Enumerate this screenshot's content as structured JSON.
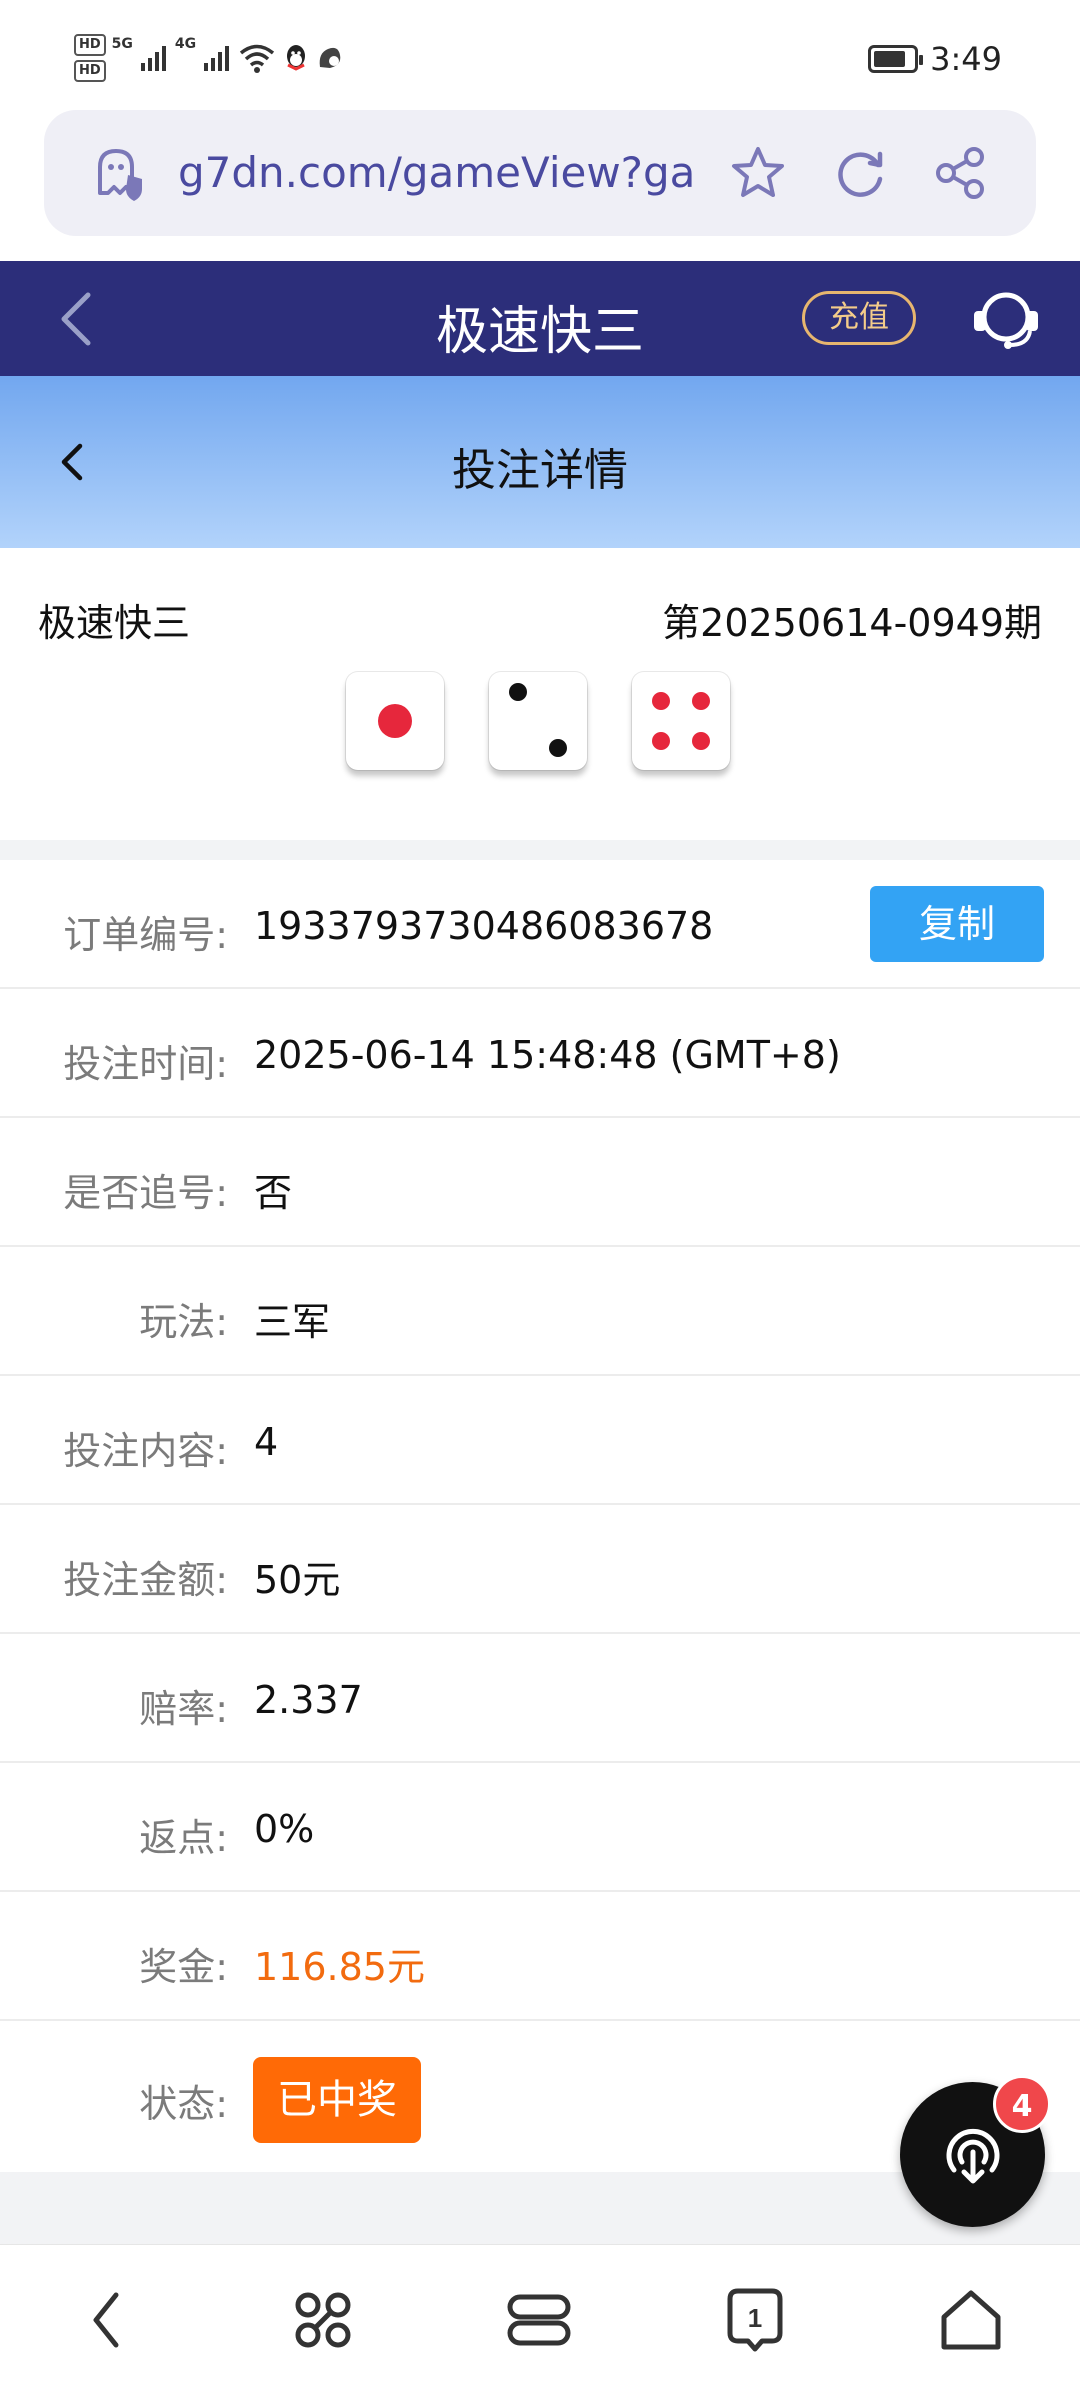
{
  "status_bar": {
    "hd1": "HD",
    "hd2": "HD",
    "net1": "5G",
    "net2": "4G",
    "time": "3:49",
    "battery_level": 0.8
  },
  "browser": {
    "url": "g7dn.com/gameView?ga"
  },
  "header": {
    "title": "极速快三",
    "recharge_label": "充值"
  },
  "sub_header": {
    "title": "投注详情"
  },
  "game": {
    "name": "极速快三",
    "period": "第20250614-0949期",
    "dice": [
      1,
      2,
      4
    ]
  },
  "details": {
    "order_no": {
      "label": "订单编号:",
      "value": "1933793730486083678",
      "copy_label": "复制"
    },
    "bet_time": {
      "label": "投注时间:",
      "value": "2025-06-14 15:48:48 (GMT+8)"
    },
    "chase": {
      "label": "是否追号:",
      "value": "否"
    },
    "play": {
      "label": "玩法:",
      "value": "三军"
    },
    "content": {
      "label": "投注内容:",
      "value": "4"
    },
    "amount": {
      "label": "投注金额:",
      "value": "50元"
    },
    "odds": {
      "label": "赔率:",
      "value": "2.337"
    },
    "rebate": {
      "label": "返点:",
      "value": "0%"
    },
    "prize": {
      "label": "奖金:",
      "value": "116.85元"
    },
    "state": {
      "label": "状态:",
      "value": "已中奖"
    }
  },
  "fab": {
    "badge": "4"
  },
  "colors": {
    "header_bg": "#2c2e7a",
    "accent_blue": "#33a3f4",
    "prize_orange": "#f26b0f",
    "status_orange": "#ff6a06",
    "pip_red": "#e6273c"
  },
  "icons": {
    "address_bar": [
      "ghost-shield-icon",
      "star-icon",
      "refresh-icon",
      "share-icon"
    ],
    "header": [
      "chevron-left-icon",
      "headset-icon"
    ],
    "bottom_nav": [
      "back-icon",
      "command-icon",
      "tabs-icon",
      "tab-count-icon",
      "home-icon"
    ],
    "fab": "download-icon"
  }
}
